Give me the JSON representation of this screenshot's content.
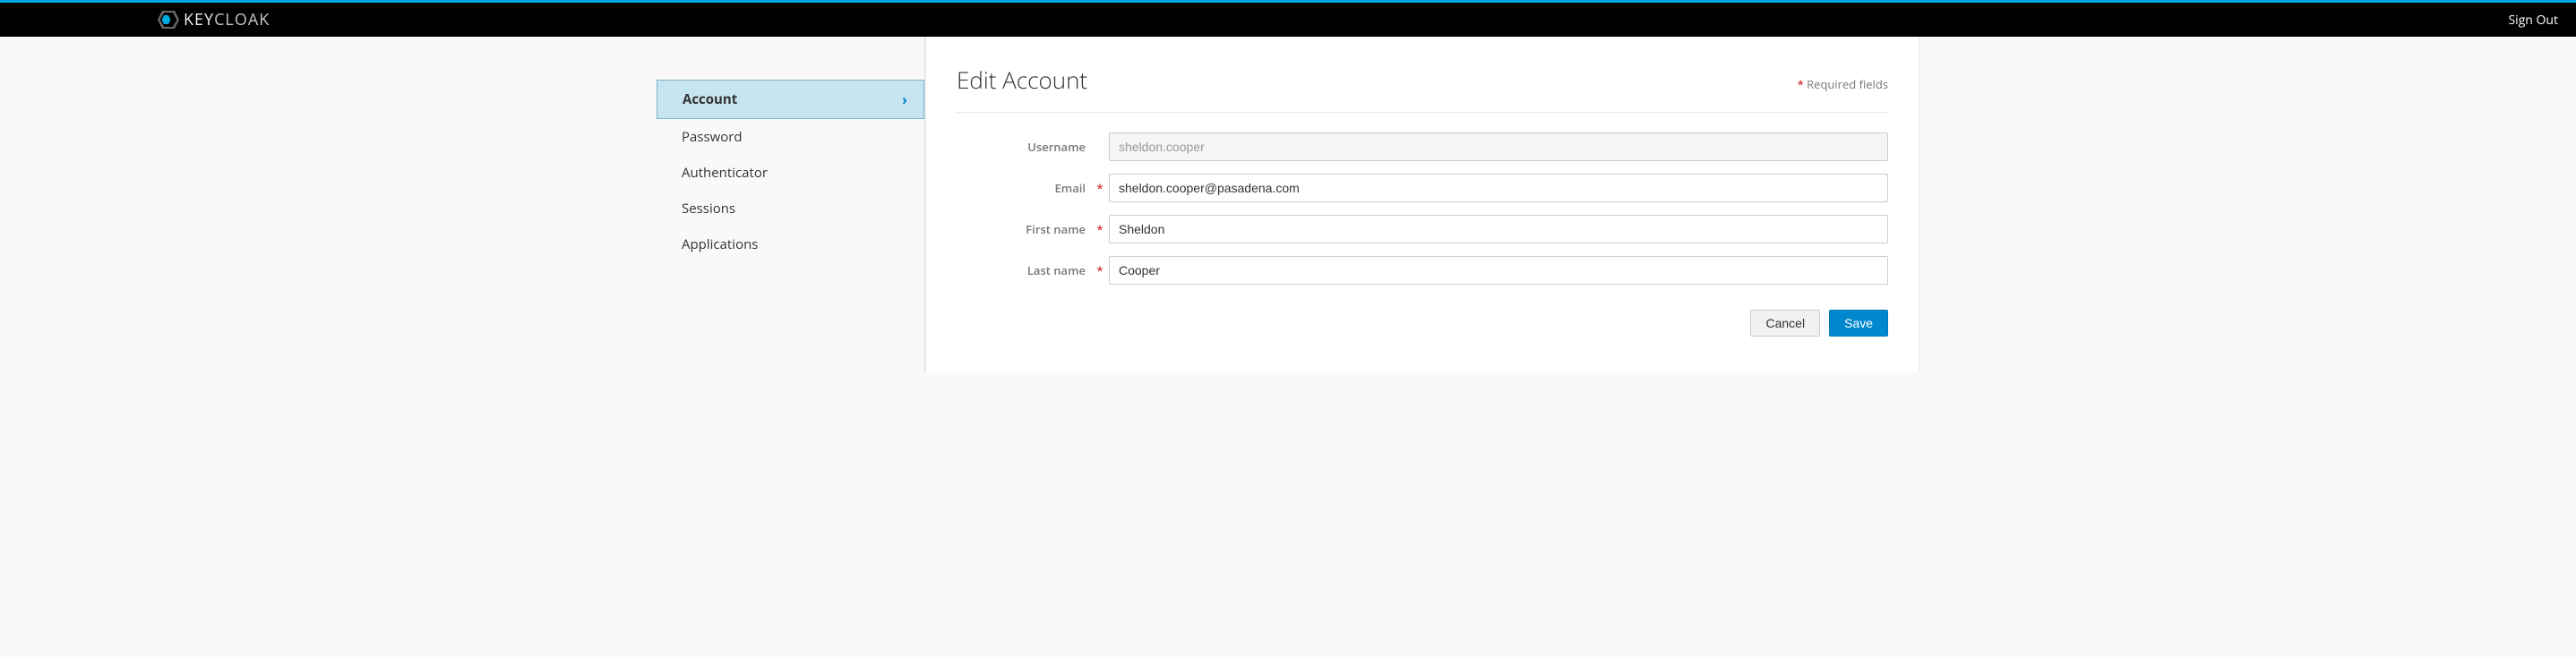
{
  "brand": {
    "key": "KEY",
    "cloak": "CLOAK"
  },
  "header": {
    "sign_out": "Sign Out"
  },
  "sidebar": {
    "items": [
      {
        "label": "Account",
        "active": true
      },
      {
        "label": "Password",
        "active": false
      },
      {
        "label": "Authenticator",
        "active": false
      },
      {
        "label": "Sessions",
        "active": false
      },
      {
        "label": "Applications",
        "active": false
      }
    ]
  },
  "page": {
    "title": "Edit Account",
    "required_note": "Required fields",
    "required_star": "*"
  },
  "form": {
    "username": {
      "label": "Username",
      "value": "sheldon.cooper",
      "required": false,
      "disabled": true
    },
    "email": {
      "label": "Email",
      "value": "sheldon.cooper@pasadena.com",
      "required": true,
      "disabled": false
    },
    "first_name": {
      "label": "First name",
      "value": "Sheldon",
      "required": true,
      "disabled": false
    },
    "last_name": {
      "label": "Last name",
      "value": "Cooper",
      "required": true,
      "disabled": false
    }
  },
  "actions": {
    "cancel": "Cancel",
    "save": "Save"
  }
}
